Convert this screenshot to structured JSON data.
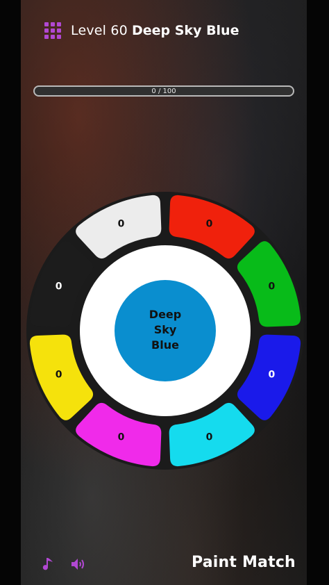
{
  "header": {
    "icon": "grid-icon",
    "level_label": "Level 60",
    "target_color_name": "Deep Sky Blue"
  },
  "progress": {
    "text": "0 / 100",
    "fraction": 0
  },
  "wheel": {
    "segments": [
      {
        "id": "red",
        "color": "#f0210c",
        "count": "0"
      },
      {
        "id": "green",
        "color": "#08bb19",
        "count": "0"
      },
      {
        "id": "blue",
        "color": "#1a1aea",
        "count": "0"
      },
      {
        "id": "cyan",
        "color": "#15dbee",
        "count": "0"
      },
      {
        "id": "magenta",
        "color": "#f02aea",
        "count": "0"
      },
      {
        "id": "yellow",
        "color": "#f5e20c",
        "count": "0"
      },
      {
        "id": "black",
        "color": "#1c1c1c",
        "count": "0"
      },
      {
        "id": "white",
        "color": "#ececec",
        "count": "0"
      }
    ],
    "mix_color": "#0a8ecf",
    "mix_label_lines": [
      "Deep",
      "Sky",
      "Blue"
    ]
  },
  "footer": {
    "music_icon": "music-note-icon",
    "sound_icon": "speaker-icon",
    "accent": "#b148d2",
    "app_title": "Paint Match"
  }
}
